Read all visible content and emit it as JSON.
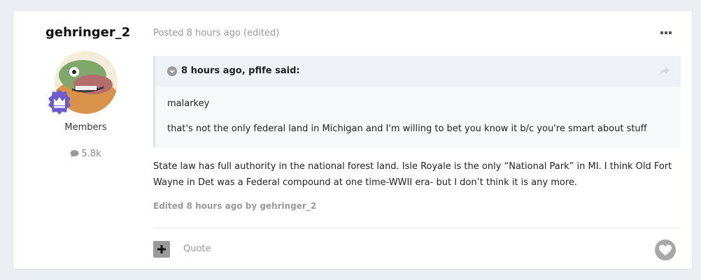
{
  "author": {
    "username": "gehringer_2",
    "group": "Members",
    "reputation": "5.8k"
  },
  "post": {
    "meta": "Posted 8 hours ago (edited)",
    "quote": {
      "citation": "8 hours ago, pfife said:",
      "paragraphs": [
        "malarkey",
        "that's not the only federal land in Michigan and I'm willing to bet you know it b/c you're smart about stuff"
      ]
    },
    "body": "State law has full authority in the national forest land. Isle Royale is the only “National Park” in MI. I think Old Fort Wayne in Det was a Federal compound at one time-WWII era- but I don’t think it is any more.",
    "edited": "Edited 8 hours ago by gehringer_2"
  },
  "actions": {
    "quote_label": "Quote"
  },
  "icons": {
    "more": "ellipsis-icon",
    "chevron": "chevron-down-circle-icon",
    "share": "share-arrow-icon",
    "comment": "comment-icon",
    "plus": "plus-icon",
    "heart": "heart-icon",
    "badge": "crown-badge-icon"
  },
  "colors": {
    "badge": "#6b5bd1",
    "muted": "#999999"
  }
}
